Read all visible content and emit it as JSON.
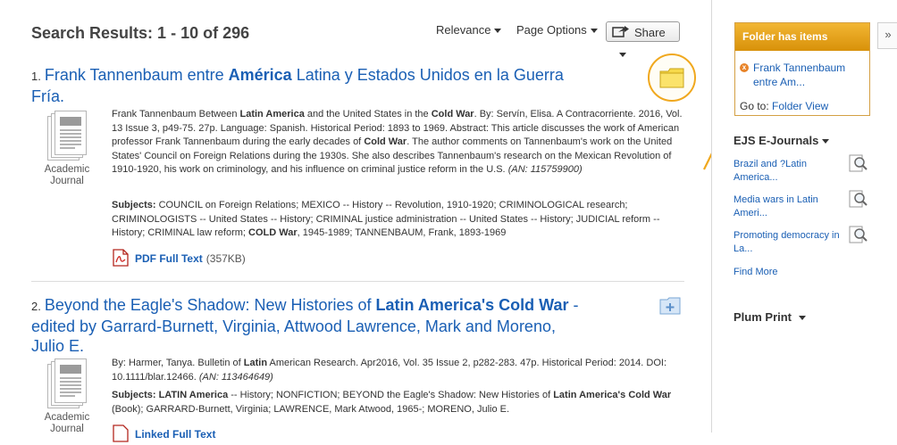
{
  "header": {
    "results_title": "Search Results: 1 - 10 of 296",
    "relevance_label": "Relevance",
    "page_options_label": "Page Options",
    "share_label": "Share"
  },
  "results": [
    {
      "number": "1.",
      "title_parts": [
        "Frank Tannenbaum entre ",
        "América",
        " Latina y Estados Unidos en la Guerra Fría."
      ],
      "type_line1": "Academic",
      "type_line2": "Journal",
      "abstract_html_parts": [
        {
          "t": "Frank Tannenbaum Between "
        },
        {
          "b": "Latin America"
        },
        {
          "t": " and the United States in the "
        },
        {
          "b": "Cold War"
        },
        {
          "t": ". By: Servín, Elisa. A Contracorriente. 2016, Vol. 13 Issue 3, p49-75. 27p. Language: Spanish. Historical Period: 1893 to 1969. Abstract: This article discusses the work of American professor Frank Tannenbaum during the early decades of "
        },
        {
          "b": "Cold War"
        },
        {
          "t": ". The author comments on Tannenbaum's work on the United States' Council on Foreign Relations during the 1930s. She also describes Tannenbaum's research on the Mexican Revolution of 1910-1920, his work on criminology, and his influence on criminal justice reform in the U.S. "
        },
        {
          "i": "(AN: 115759900)"
        }
      ],
      "subjects_label": "Subjects:",
      "subjects_parts": [
        {
          "t": " COUNCIL on Foreign Relations; MEXICO -- History -- Revolution, 1910-1920; CRIMINOLOGICAL research; CRIMINOLOGISTS -- United States -- History; CRIMINAL justice administration -- United States -- History; JUDICIAL reform -- History; CRIMINAL law reform; "
        },
        {
          "b": "COLD War"
        },
        {
          "t": ", 1945-1989; TANNENBAUM, Frank, 1893-1969"
        }
      ],
      "fulltext_label": "PDF Full Text",
      "fulltext_size": "(357KB)"
    },
    {
      "number": "2.",
      "title_parts": [
        "Beyond the Eagle's Shadow: New Histories of ",
        "Latin America's Cold War",
        " - edited by Garrard-Burnett, Virginia, Attwood Lawrence, Mark and Moreno, Julio E."
      ],
      "type_line1": "Academic",
      "type_line2": "Journal",
      "abstract_html_parts": [
        {
          "t": "By: Harmer, Tanya. Bulletin of "
        },
        {
          "b": "Latin"
        },
        {
          "t": " American Research. Apr2016, Vol. 35 Issue 2, p282-283. 47p. Historical Period: 2014. DOI: 10.1111/blar.12466. "
        },
        {
          "i": "(AN: 113464649)"
        }
      ],
      "subjects_label": "Subjects:",
      "subjects_parts": [
        {
          "b": " LATIN America"
        },
        {
          "t": " -- History; NONFICTION; BEYOND the Eagle's Shadow: New Histories of "
        },
        {
          "b": "Latin America's Cold War"
        },
        {
          "t": " (Book); GARRARD-Burnett, Virginia; LAWRENCE, Mark Atwood, 1965-; MORENO, Julio E."
        }
      ],
      "fulltext_label": "Linked Full Text"
    }
  ],
  "folder": {
    "header": "Folder has items",
    "item": "Frank Tannenbaum entre Am...",
    "goto_label": "Go to:",
    "goto_link": "Folder View"
  },
  "ejs": {
    "header": "EJS E-Journals",
    "items": [
      "Brazil and ?Latin America...",
      "Media wars in Latin Ameri...",
      "Promoting democracy in La..."
    ],
    "find_more": "Find More"
  },
  "plum": {
    "header": "Plum Print"
  },
  "colors": {
    "link": "#1a5fb4",
    "accent": "#f0a81e",
    "folder_header": "#e5a21c"
  },
  "icons": [
    "folder-icon",
    "pdf-icon",
    "share-icon",
    "magnifier-icon",
    "add-to-folder-icon",
    "remove-icon",
    "document-stack-icon",
    "arrow-annotation"
  ]
}
